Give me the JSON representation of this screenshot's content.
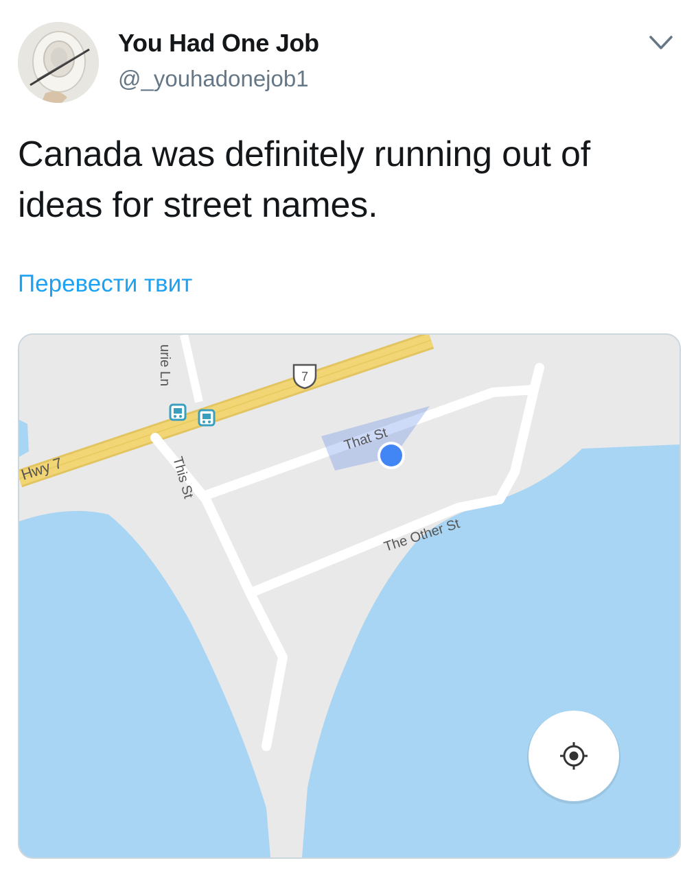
{
  "tweet": {
    "display_name": "You Had One Job",
    "handle": "@_youhadonejob1",
    "text": "Canada was definitely running out of ideas for street names.",
    "translate_link": "Перевести твит"
  },
  "map": {
    "highway_label": "Hwy 7",
    "highway_shield": "7",
    "streets": {
      "partial_street": "urie Ln",
      "this_st": "This St",
      "that_st": "That St",
      "the_other_st": "The Other St"
    },
    "icons": [
      "bus-stop-icon",
      "bus-stop-icon",
      "location-dot-icon",
      "my-location-icon",
      "highway-shield-icon"
    ],
    "colors": {
      "land": "#e9e9e9",
      "water": "#a8d5f3",
      "highway": "#f2d675",
      "road": "#ffffff",
      "location_dot": "#4285f4",
      "link": "#1da1f2"
    }
  }
}
